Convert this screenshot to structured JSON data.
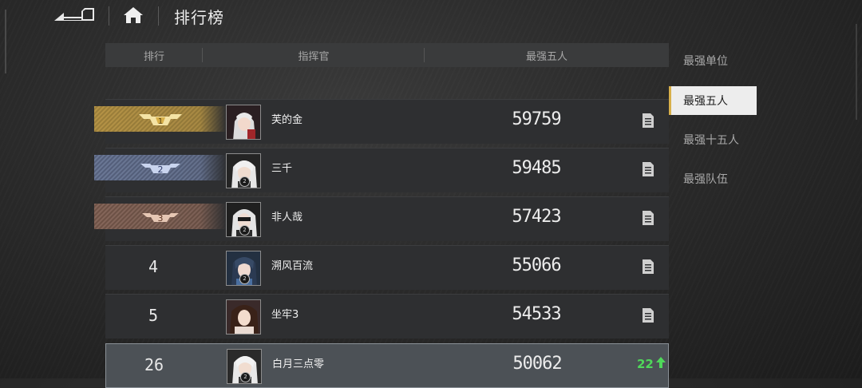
{
  "header": {
    "title": "排行榜",
    "back_icon": "back-arrow-icon",
    "home_icon": "home-icon"
  },
  "table": {
    "columns": [
      "排行",
      "指挥官",
      "最强五人"
    ],
    "rows": [
      {
        "rank": "1",
        "rank_style": "gold",
        "name": "芙的金",
        "score": "59759",
        "badge_color": "#d8b04a"
      },
      {
        "rank": "2",
        "rank_style": "silver",
        "name": "三千",
        "score": "59485",
        "badge_color": "#8fa3d6"
      },
      {
        "rank": "3",
        "rank_style": "bronze",
        "name": "非人哉",
        "score": "57423",
        "badge_color": "#c08a6a"
      },
      {
        "rank": "4",
        "rank_style": "plain",
        "name": "溯风百流",
        "score": "55066"
      },
      {
        "rank": "5",
        "rank_style": "plain",
        "name": "坐牢3",
        "score": "54533"
      },
      {
        "rank": "26",
        "rank_style": "self",
        "name": "白月三点零",
        "score": "50062",
        "change": "22",
        "change_color": "#4fd85a"
      }
    ]
  },
  "side_menu": {
    "items": [
      "最强单位",
      "最强五人",
      "最强十五人",
      "最强队伍"
    ],
    "active_index": 1,
    "accent": "#d8b04a"
  }
}
